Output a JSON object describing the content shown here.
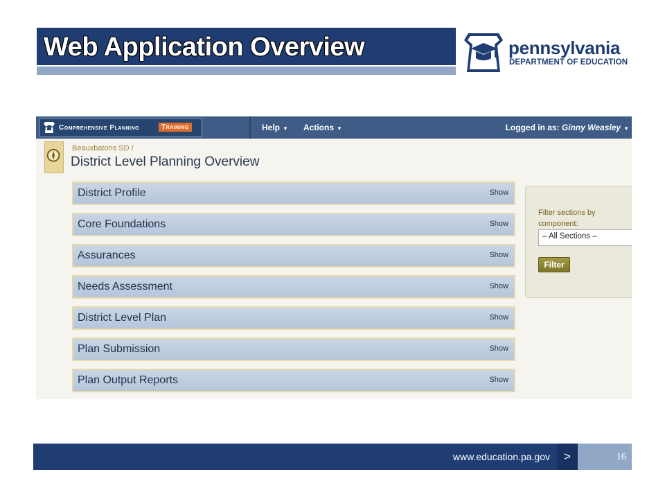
{
  "slide": {
    "title": "Web Application Overview",
    "logo": {
      "name": "pennsylvania",
      "subtitle": "DEPARTMENT OF EDUCATION"
    },
    "footer": {
      "url": "www.education.pa.gov",
      "next_glyph": ">",
      "page_number": "16"
    }
  },
  "app": {
    "brand": {
      "name": "Comprehensive Planning",
      "badge": "Training"
    },
    "nav": {
      "help": "Help",
      "actions": "Actions"
    },
    "login": {
      "prefix": "Logged in as:",
      "user": "Ginny Weasley"
    },
    "breadcrumb": "Beauxbatons SD  /",
    "page_title": "District Level Planning Overview",
    "sections": [
      {
        "label": "District Profile",
        "action": "Show"
      },
      {
        "label": "Core Foundations",
        "action": "Show"
      },
      {
        "label": "Assurances",
        "action": "Show"
      },
      {
        "label": "Needs Assessment",
        "action": "Show"
      },
      {
        "label": "District Level Plan",
        "action": "Show"
      },
      {
        "label": "Plan Submission",
        "action": "Show"
      },
      {
        "label": "Plan Output Reports",
        "action": "Show"
      }
    ],
    "filter": {
      "label": "Filter sections by component:",
      "selected": "– All Sections –",
      "button": "Filter"
    }
  },
  "colors": {
    "slide_blue": "#1f3d73",
    "accent_orange": "#e06c2c",
    "section_gold_border": "#e7daa6",
    "filter_button_olive": "#8c8432"
  },
  "icons": [
    "keystone-graduation-cap-icon",
    "keystone-icon",
    "compass-icon",
    "caret-down-icon",
    "select-arrow-icon"
  ]
}
